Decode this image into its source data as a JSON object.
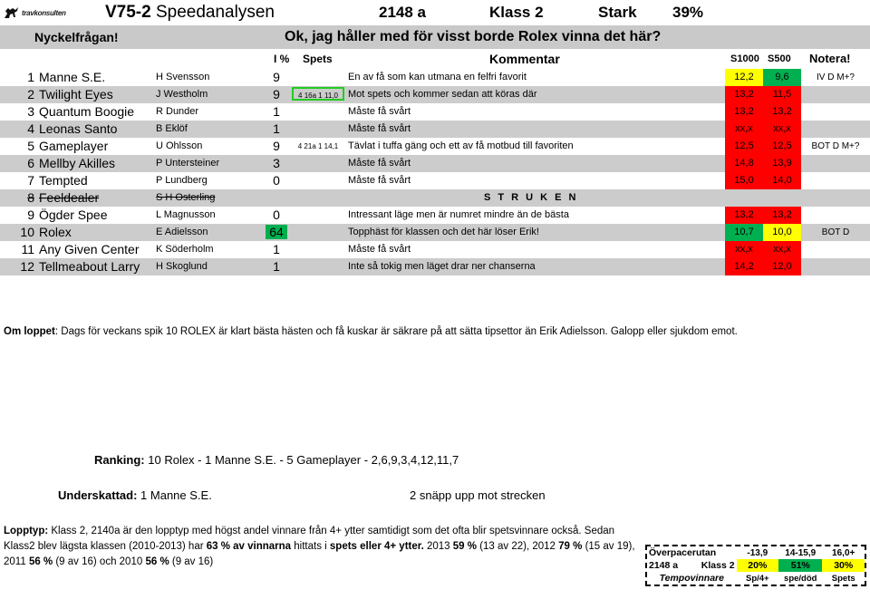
{
  "header": {
    "logo_name": "travkonsulten-logo",
    "logo_text": "travkonsulten",
    "race_code": "V75-2",
    "title": "Speedanalysen",
    "distance": "2148 a",
    "klass": "Klass 2",
    "strength": "Stark",
    "percent": "39%"
  },
  "banner": {
    "label": "Nyckelfrågan!",
    "answer": "Ok, jag håller med för visst borde Rolex vinna det här?"
  },
  "columns": {
    "ipct": "I %",
    "spets": "Spets",
    "kommentar": "Kommentar",
    "s1000": "S1000",
    "s500": "S500",
    "notera": "Notera!"
  },
  "rows": [
    {
      "num": "1",
      "horse": "Manne S.E.",
      "driver": "H Svensson",
      "ipct": "9",
      "spets": "",
      "spets_boxed": false,
      "comment": "En av få som kan utmana en felfri favorit",
      "s1000": "12,2",
      "s1000_bg": "bg-yellow",
      "s500": "9,6",
      "s500_bg": "bg-green",
      "notera": "IV D M+?",
      "struck": false,
      "alt": false
    },
    {
      "num": "2",
      "horse": "Twilight Eyes",
      "driver": "J Westholm",
      "ipct": "9",
      "spets": "4 16a 1 11,0",
      "spets_boxed": true,
      "comment": "Mot spets och kommer sedan att köras där",
      "s1000": "13,2",
      "s1000_bg": "bg-red",
      "s500": "11,5",
      "s500_bg": "bg-red",
      "notera": "",
      "struck": false,
      "alt": true
    },
    {
      "num": "3",
      "horse": "Quantum Boogie",
      "driver": "R Dunder",
      "ipct": "1",
      "spets": "",
      "spets_boxed": false,
      "comment": "Måste få svårt",
      "s1000": "13,2",
      "s1000_bg": "bg-red",
      "s500": "13,2",
      "s500_bg": "bg-red",
      "notera": "",
      "struck": false,
      "alt": false
    },
    {
      "num": "4",
      "horse": "Leonas Santo",
      "driver": "B Eklöf",
      "ipct": "1",
      "spets": "",
      "spets_boxed": false,
      "comment": "Måste få svårt",
      "s1000": "xx,x",
      "s1000_bg": "bg-red",
      "s500": "xx,x",
      "s500_bg": "bg-red",
      "notera": "",
      "struck": false,
      "alt": true
    },
    {
      "num": "5",
      "horse": "Gameplayer",
      "driver": "U Ohlsson",
      "ipct": "9",
      "spets": "4 21a 1 14,1",
      "spets_boxed": false,
      "comment": "Tävlat i tuffa gäng och ett av få motbud till favoriten",
      "s1000": "12,5",
      "s1000_bg": "bg-red",
      "s500": "12,5",
      "s500_bg": "bg-red",
      "notera": "BOT D M+?",
      "struck": false,
      "alt": false
    },
    {
      "num": "6",
      "horse": "Mellby Akilles",
      "driver": "P Untersteiner",
      "ipct": "3",
      "spets": "",
      "spets_boxed": false,
      "comment": "Måste få svårt",
      "s1000": "14,8",
      "s1000_bg": "bg-red",
      "s500": "13,9",
      "s500_bg": "bg-red",
      "notera": "",
      "struck": false,
      "alt": true
    },
    {
      "num": "7",
      "horse": "Tempted",
      "driver": "P Lundberg",
      "ipct": "0",
      "spets": "",
      "spets_boxed": false,
      "comment": "Måste få svårt",
      "s1000": "15,0",
      "s1000_bg": "bg-red",
      "s500": "14,0",
      "s500_bg": "bg-red",
      "notera": "",
      "struck": false,
      "alt": false
    },
    {
      "num": "8",
      "horse": "Feeldealer",
      "driver": "S H Osterling",
      "ipct": "",
      "spets": "",
      "spets_boxed": false,
      "comment": "S T R U K E N",
      "s1000": "",
      "s1000_bg": "bg-none",
      "s500": "",
      "s500_bg": "bg-none",
      "notera": "",
      "struck": true,
      "alt": true
    },
    {
      "num": "9",
      "horse": "Ögder Spee",
      "driver": "L Magnusson",
      "ipct": "0",
      "spets": "",
      "spets_boxed": false,
      "comment": "Intressant läge men är numret mindre än de bästa",
      "s1000": "13,2",
      "s1000_bg": "bg-red",
      "s500": "13,2",
      "s500_bg": "bg-red",
      "notera": "",
      "struck": false,
      "alt": false
    },
    {
      "num": "10",
      "horse": "Rolex",
      "driver": "E Adielsson",
      "ipct": "64",
      "spets": "",
      "spets_boxed": false,
      "ipct_hl": true,
      "comment": "Topphäst för klassen och det här löser Erik!",
      "s1000": "10,7",
      "s1000_bg": "bg-green",
      "s500": "10,0",
      "s500_bg": "bg-yellow",
      "notera": "BOT D",
      "struck": false,
      "alt": true
    },
    {
      "num": "11",
      "horse": "Any Given Center",
      "driver": "K Söderholm",
      "ipct": "1",
      "spets": "",
      "spets_boxed": false,
      "comment": "Måste få svårt",
      "s1000": "xx,x",
      "s1000_bg": "bg-red",
      "s500": "xx,x",
      "s500_bg": "bg-red",
      "notera": "",
      "struck": false,
      "alt": false
    },
    {
      "num": "12",
      "horse": "Tellmeabout Larry",
      "driver": "H Skoglund",
      "ipct": "1",
      "spets": "",
      "spets_boxed": false,
      "comment": "Inte så tokig men läget drar ner chanserna",
      "s1000": "14,2",
      "s1000_bg": "bg-red",
      "s500": "12,0",
      "s500_bg": "bg-red",
      "notera": "",
      "struck": false,
      "alt": true
    }
  ],
  "om_loppet": {
    "label": "Om loppet",
    "text": ": Dags för veckans spik 10 ROLEX är klart bästa hästen och få kuskar är säkrare på att sätta tipsettor än Erik Adielsson. Galopp eller sjukdom emot."
  },
  "ranking": {
    "label": "Ranking:",
    "value": "10 Rolex - 1 Manne S.E. - 5 Gameplayer - 2,6,9,3,4,12,11,7"
  },
  "underskattad": {
    "label": "Underskattad:",
    "value": "1 Manne S.E.",
    "note": "2 snäpp upp mot strecken"
  },
  "lopptyp": {
    "label": "Lopptyp:",
    "part1": " Klass 2, 2140a är den lopptyp med högst andel vinnare från 4+ ytter samtidigt som det ofta blir spetsvinnare också. Sedan Klass2 blev lägsta klassen (2010-2013) har ",
    "bold1": "63 % av vinnarna",
    "part2": " hittats i ",
    "bold2": "spets eller 4+ ytter.",
    "part3": " 2013 ",
    "bold3": "59 %",
    "part4": " (13 av 22), 2012 ",
    "bold4": "79 %",
    "part5": " (15 av 19), 2011 ",
    "bold5": "56 %",
    "part6": " (9 av 16) och 2010 ",
    "bold6": "56 %",
    "part7": " (9 av 16)"
  },
  "statbox": {
    "title": "Överpacerutan",
    "distance": "2148 a",
    "klass": "Klass 2",
    "subtitle": "Tempovinnare",
    "headers": [
      "-13,9",
      "14-15,9",
      "16,0+"
    ],
    "values": [
      "20%",
      "51%",
      "30%"
    ],
    "value_bgs": [
      "bg-yellow",
      "bg-green",
      "bg-yellow"
    ],
    "footers": [
      "Sp/4+",
      "spe/död",
      "Spets"
    ]
  }
}
